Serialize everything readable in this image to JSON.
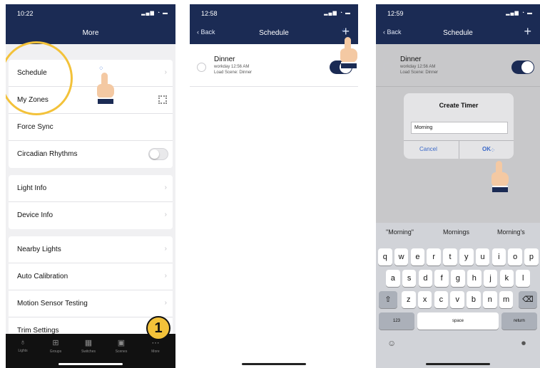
{
  "screen1": {
    "time": "10:22",
    "title": "More",
    "group1": [
      "Schedule",
      "My Zones",
      "Force Sync",
      "Circadian Rhythms"
    ],
    "group2": [
      "Light Info",
      "Device Info"
    ],
    "group3": [
      "Nearby Lights",
      "Auto Calibration",
      "Motion Sensor Testing",
      "Trim Settings"
    ],
    "tabs": [
      "Lights",
      "Groups",
      "Switches",
      "Scenes",
      "More"
    ],
    "step_badge": "1"
  },
  "screen2": {
    "time": "12:58",
    "back": "Back",
    "title": "Schedule",
    "item": {
      "name": "Dinner",
      "line1": "workday 12:56 AM",
      "line2": "Load Scene: Dinner",
      "enabled": true
    }
  },
  "screen3": {
    "time": "12:59",
    "back": "Back",
    "title": "Schedule",
    "item": {
      "name": "Dinner",
      "line1": "workday 12:56 AM",
      "line2": "Load Scene: Dinner",
      "enabled": true
    },
    "dialog": {
      "title": "Create Timer",
      "input_value": "Morning",
      "cancel": "Cancel",
      "ok": "OK"
    },
    "suggestions": [
      "\"Morning\"",
      "Mornings",
      "Morning's"
    ],
    "keys_row1": [
      "q",
      "w",
      "e",
      "r",
      "t",
      "y",
      "u",
      "i",
      "o",
      "p"
    ],
    "keys_row2": [
      "a",
      "s",
      "d",
      "f",
      "g",
      "h",
      "j",
      "k",
      "l"
    ],
    "keys_row3": [
      "z",
      "x",
      "c",
      "v",
      "b",
      "n",
      "m"
    ],
    "key_123": "123",
    "key_space": "space",
    "key_return": "return"
  },
  "colors": {
    "navbar": "#1b2b54",
    "highlight": "#f3c23a",
    "link": "#3a68c8"
  },
  "icons": [
    "chevron-right-icon",
    "qr-icon",
    "plus-icon",
    "clock-icon",
    "hand-pointer-icon",
    "shift-icon",
    "delete-icon",
    "emoji-icon",
    "mic-icon"
  ]
}
